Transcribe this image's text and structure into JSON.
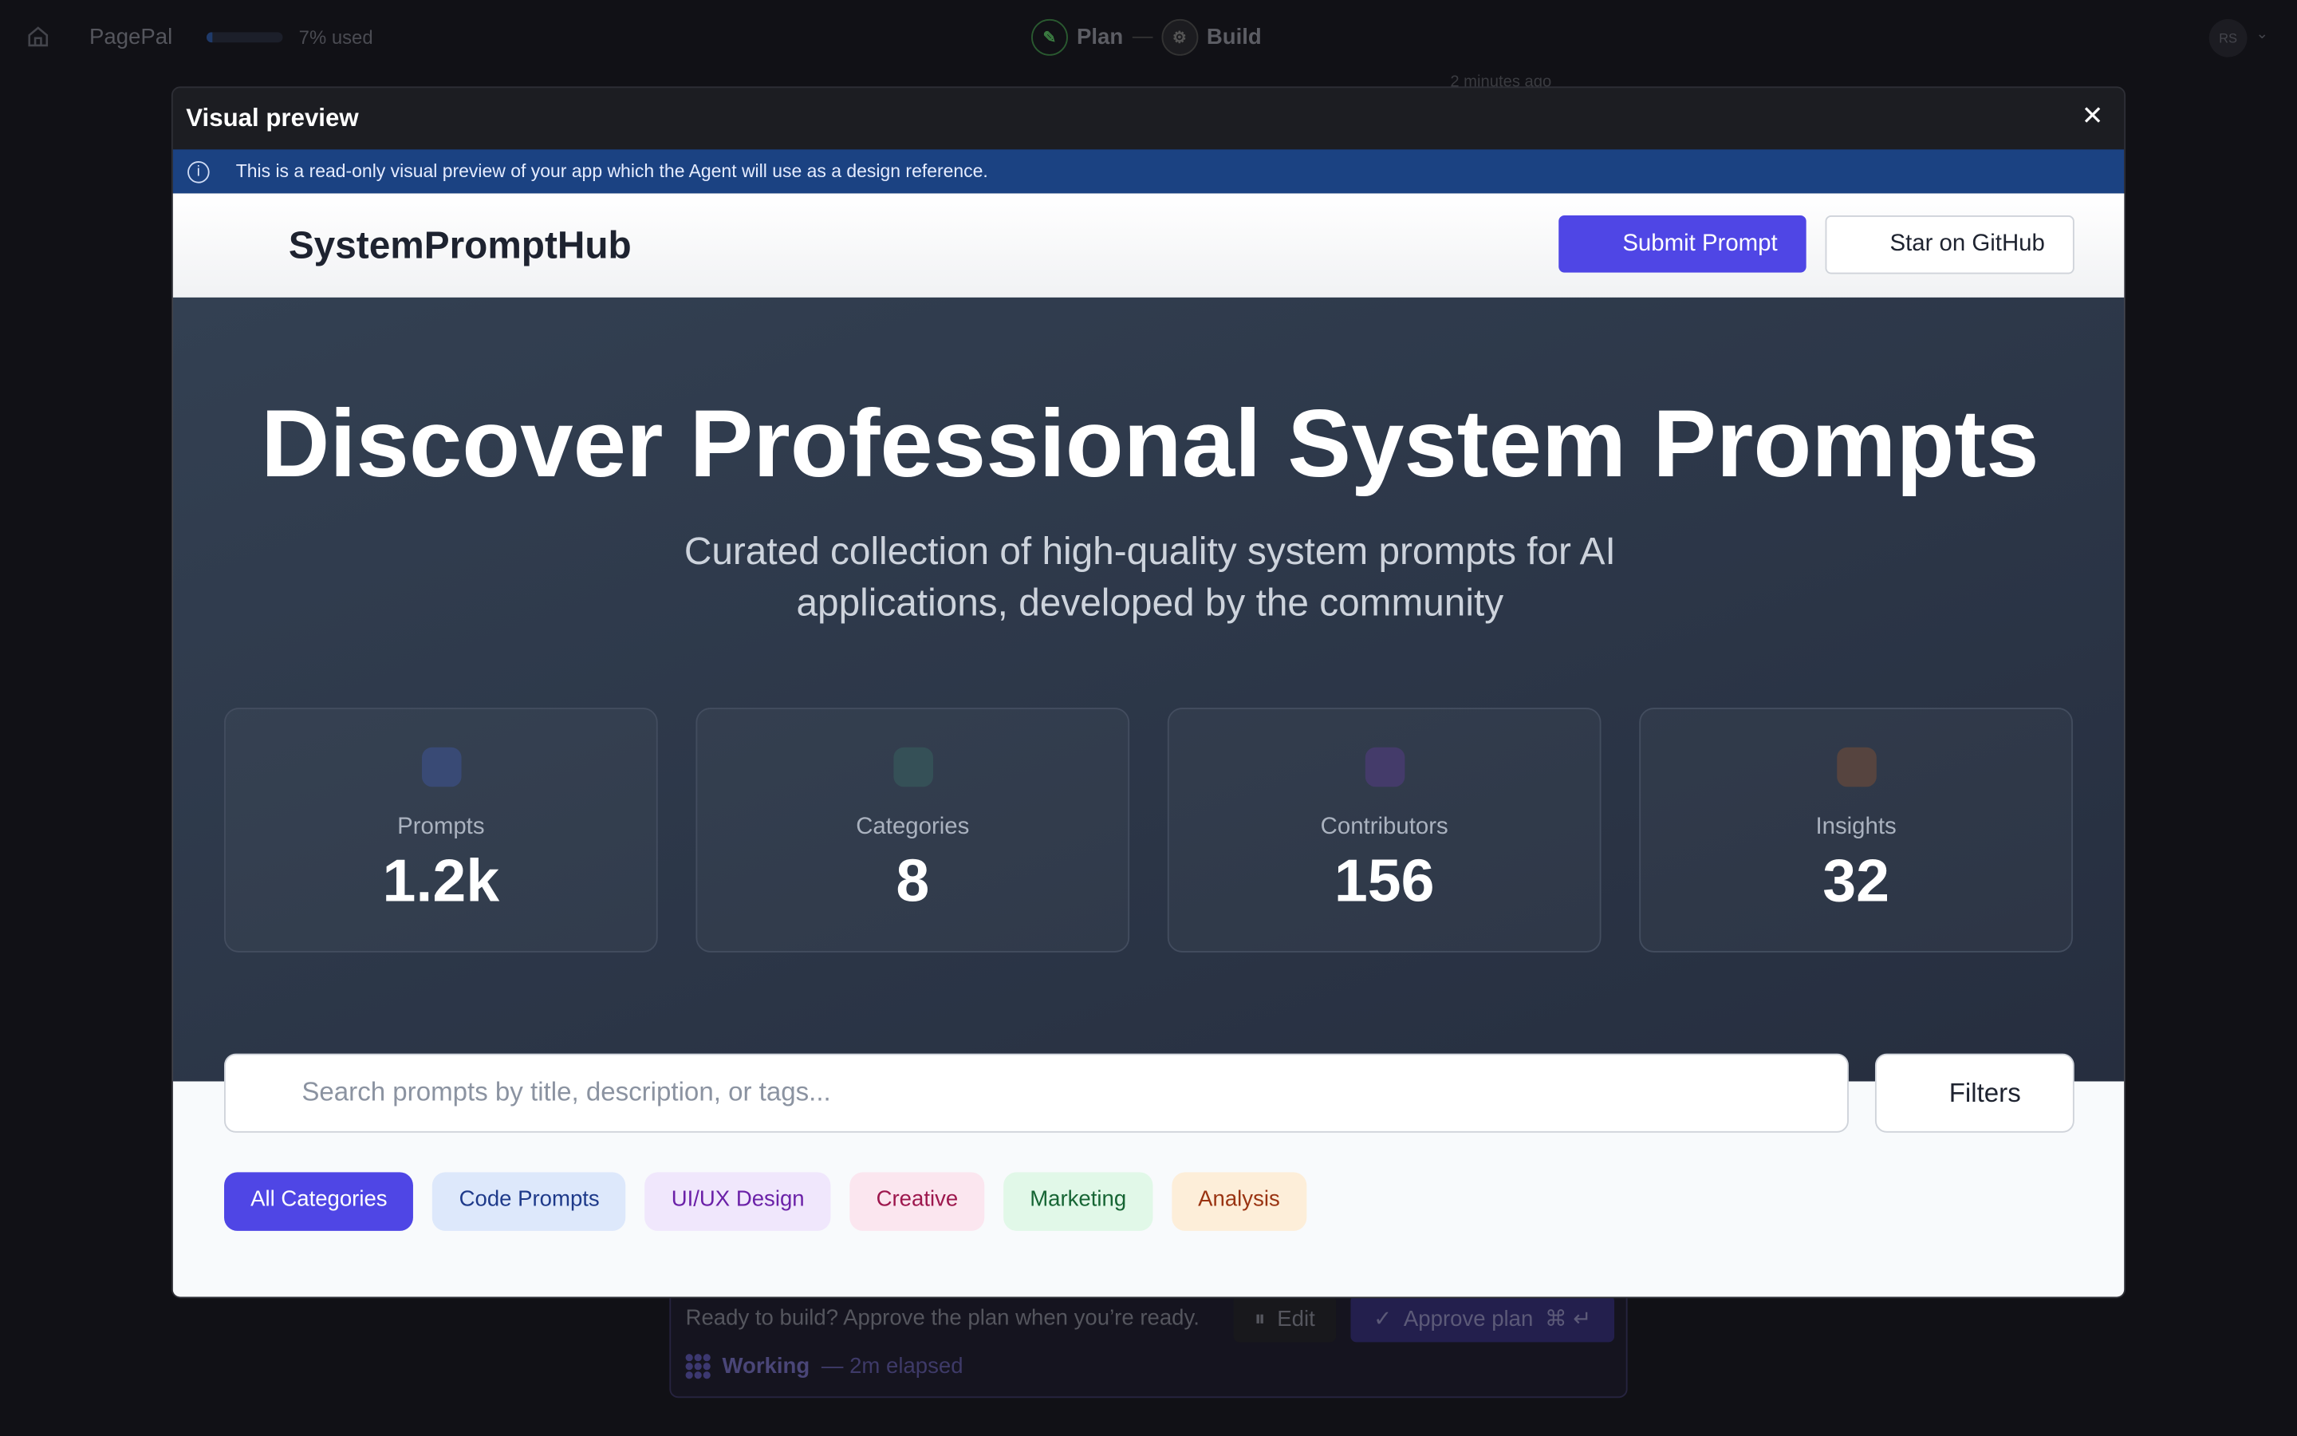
{
  "topbar": {
    "brand": "PagePal",
    "usage": "7% used",
    "usage_fraction": 0.07,
    "modes": [
      "Plan",
      "Build"
    ],
    "avatar": "RS",
    "ago": "2 minutes ago"
  },
  "bottom": {
    "message": "Ready to build? Approve the plan when you’re ready.",
    "edit": "Edit",
    "approve": "Approve plan",
    "shortcut": "⌘ ↵",
    "working": "Working",
    "elapsed": "— 2m elapsed"
  },
  "modal": {
    "title": "Visual preview",
    "info": "This is a read-only visual preview of your app which the Agent will use as a design reference."
  },
  "app": {
    "logo": "SystemPromptHub",
    "submit": "Submit Prompt",
    "star": "Star on GitHub",
    "hero_title": "Discover Professional System Prompts",
    "hero_subtitle": "Curated collection of high-quality system prompts for AI applications, developed by the community",
    "stats": [
      {
        "label": "Prompts",
        "value": "1.2k",
        "color": "#394a75"
      },
      {
        "label": "Categories",
        "value": "8",
        "color": "#355057"
      },
      {
        "label": "Contributors",
        "value": "156",
        "color": "#443b6a"
      },
      {
        "label": "Insights",
        "value": "32",
        "color": "#56443f"
      }
    ],
    "search_placeholder": "Search prompts by title, description, or tags...",
    "filters": "Filters",
    "chips": [
      {
        "label": "All Categories",
        "bg": "#4f46e5",
        "fg": "#ffffff"
      },
      {
        "label": "Code Prompts",
        "bg": "#dde8fb",
        "fg": "#1e3a8a"
      },
      {
        "label": "UI/UX Design",
        "bg": "#f0e7fc",
        "fg": "#6b21a8"
      },
      {
        "label": "Creative",
        "bg": "#fbe6ef",
        "fg": "#9d174d"
      },
      {
        "label": "Marketing",
        "bg": "#e1f8e8",
        "fg": "#166534"
      },
      {
        "label": "Analysis",
        "bg": "#fdeed9",
        "fg": "#9a3412"
      }
    ]
  }
}
